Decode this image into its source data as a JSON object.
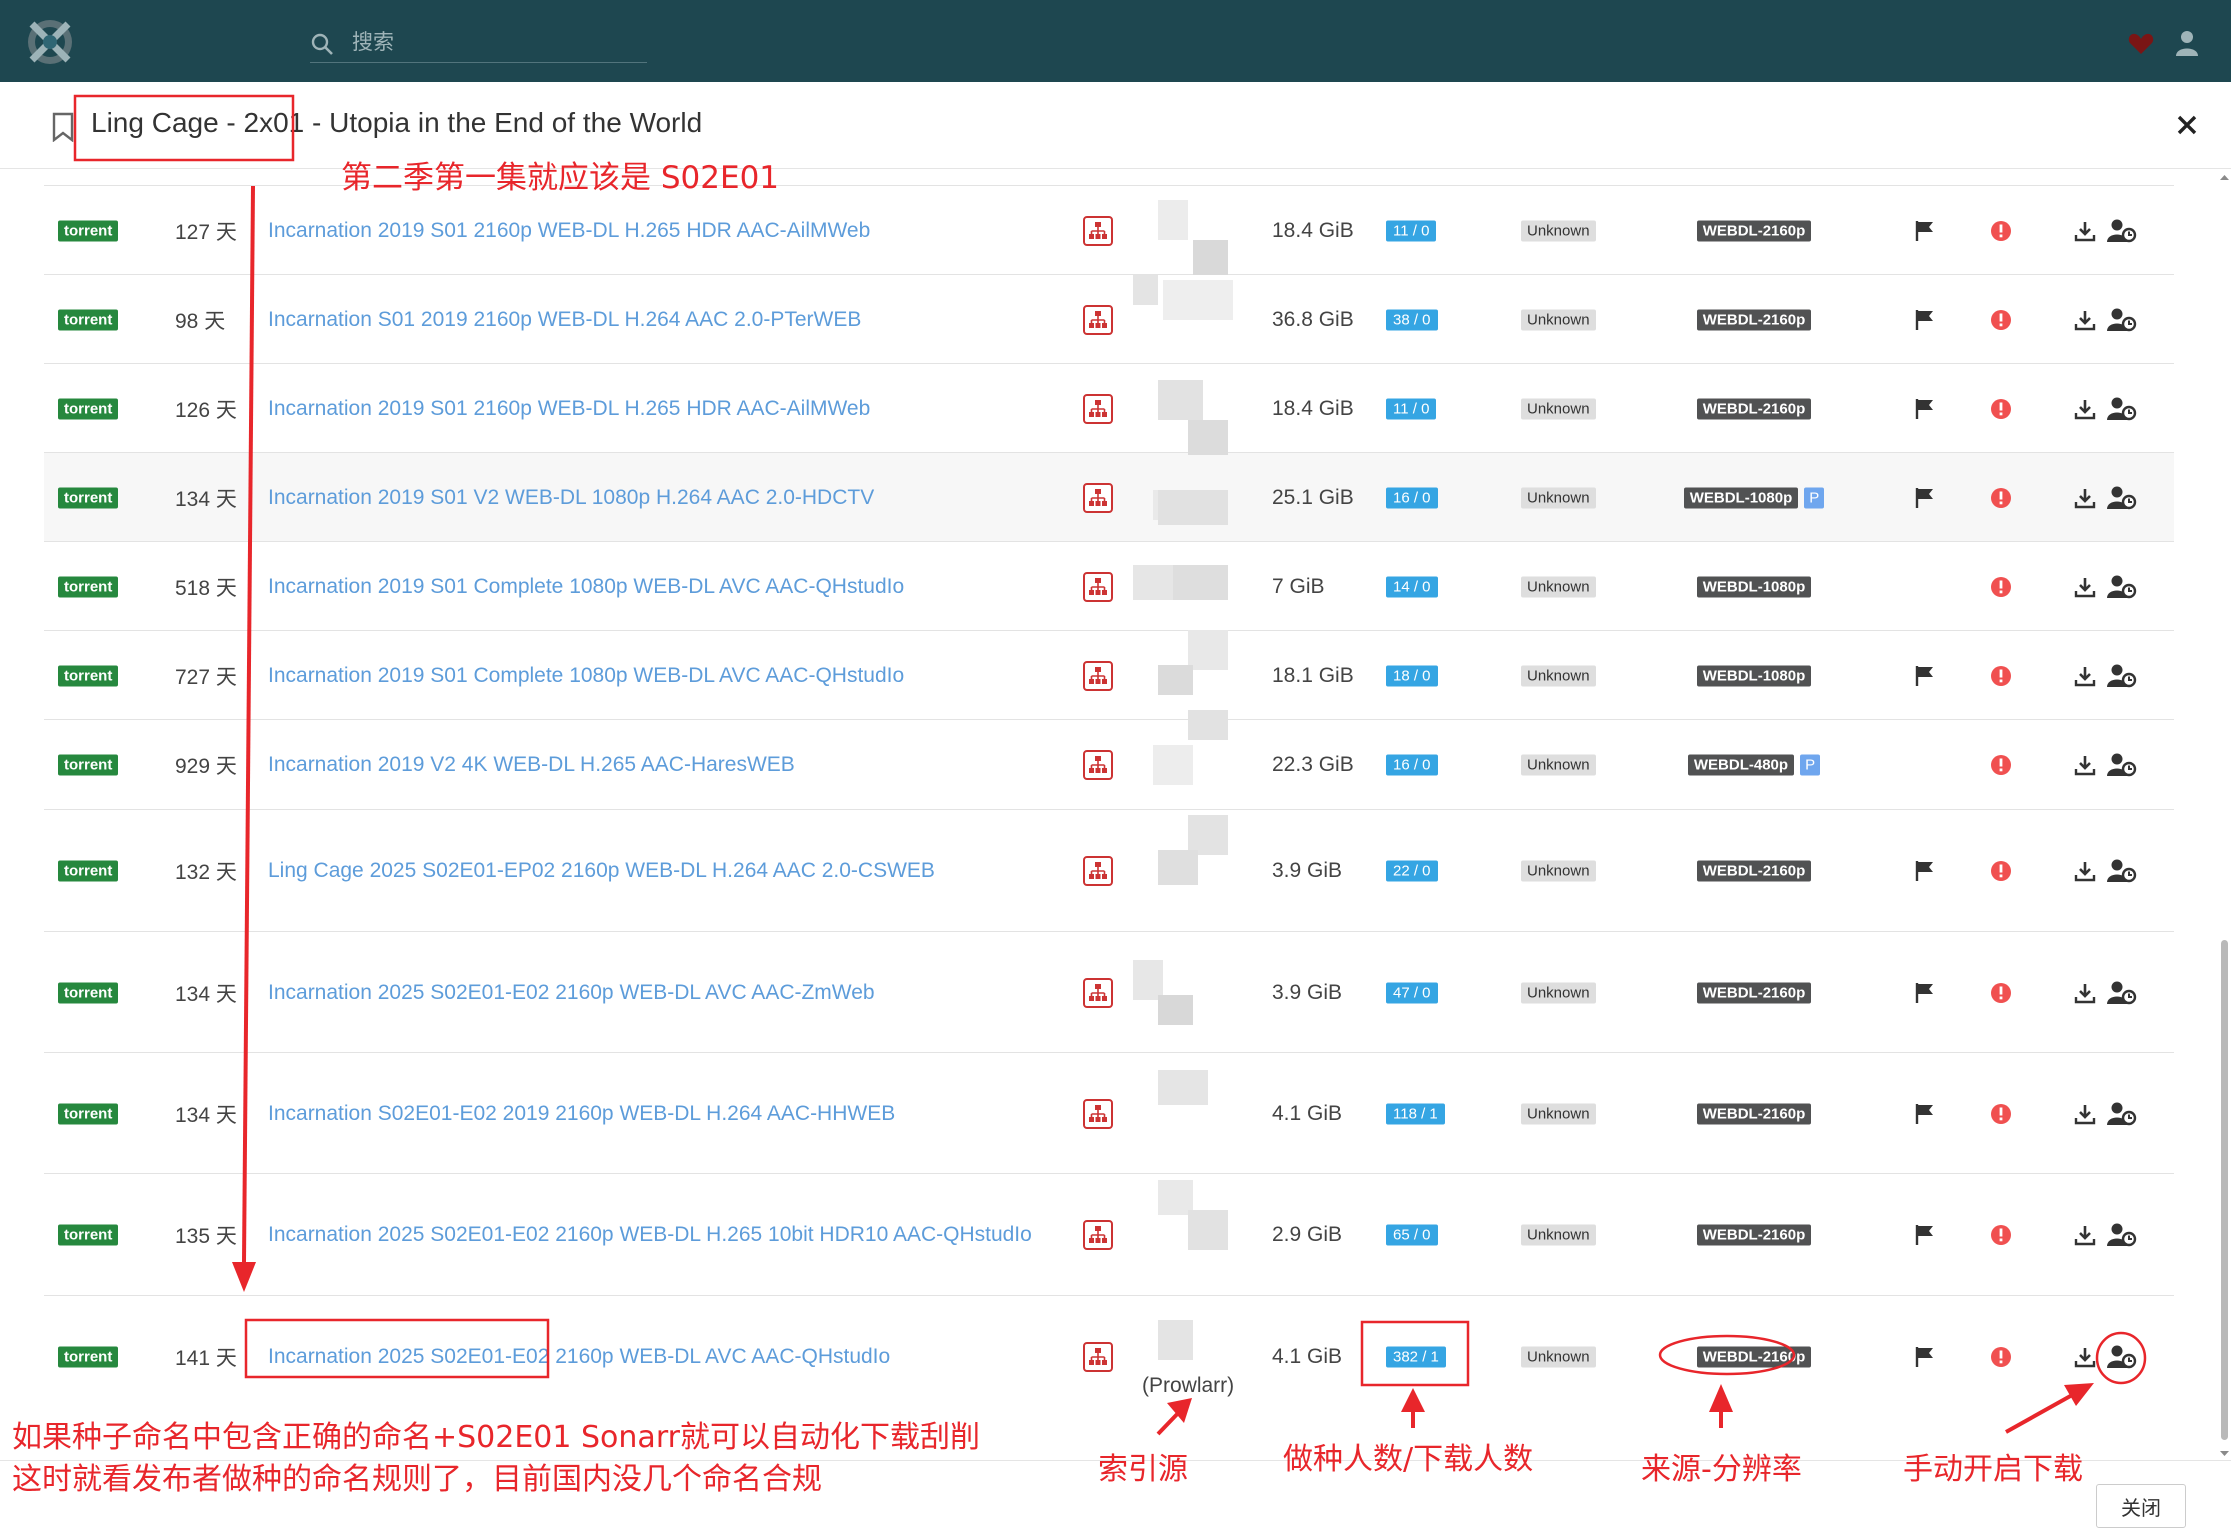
{
  "header": {
    "search_placeholder": "搜索"
  },
  "modal": {
    "title": "Ling Cage - 2x01 - Utopia in the End of the World",
    "close_label": "关闭"
  },
  "releases": [
    {
      "protocol": "torrent",
      "age": "127 天",
      "title": "Incarnation 2019 S01 2160p WEB-DL H.265 HDR AAC-AilMWeb",
      "size": "18.4 GiB",
      "peers": "11 / 0",
      "language": "Unknown",
      "quality": "WEBDL-2160p",
      "proper": "",
      "flag": true
    },
    {
      "protocol": "torrent",
      "age": "98 天",
      "title": "Incarnation S01 2019 2160p WEB-DL H.264 AAC 2.0-PTerWEB",
      "size": "36.8 GiB",
      "peers": "38 / 0",
      "language": "Unknown",
      "quality": "WEBDL-2160p",
      "proper": "",
      "flag": true
    },
    {
      "protocol": "torrent",
      "age": "126 天",
      "title": "Incarnation 2019 S01 2160p WEB-DL H.265 HDR AAC-AilMWeb",
      "size": "18.4 GiB",
      "peers": "11 / 0",
      "language": "Unknown",
      "quality": "WEBDL-2160p",
      "proper": "",
      "flag": true
    },
    {
      "protocol": "torrent",
      "age": "134 天",
      "title": "Incarnation 2019 S01 V2 WEB-DL 1080p H.264 AAC 2.0-HDCTV",
      "size": "25.1 GiB",
      "peers": "16 / 0",
      "language": "Unknown",
      "quality": "WEBDL-1080p",
      "proper": "P",
      "flag": true
    },
    {
      "protocol": "torrent",
      "age": "518 天",
      "title": "Incarnation 2019 S01 Complete 1080p WEB-DL AVC AAC-QHstudIo",
      "size": "7 GiB",
      "peers": "14 / 0",
      "language": "Unknown",
      "quality": "WEBDL-1080p",
      "proper": "",
      "flag": false
    },
    {
      "protocol": "torrent",
      "age": "727 天",
      "title": "Incarnation 2019 S01 Complete 1080p WEB-DL AVC AAC-QHstudIo",
      "size": "18.1 GiB",
      "peers": "18 / 0",
      "language": "Unknown",
      "quality": "WEBDL-1080p",
      "proper": "",
      "flag": true
    },
    {
      "protocol": "torrent",
      "age": "929 天",
      "title": "Incarnation 2019 V2 4K WEB-DL H.265 AAC-HaresWEB",
      "size": "22.3 GiB",
      "peers": "16 / 0",
      "language": "Unknown",
      "quality": "WEBDL-480p",
      "proper": "P",
      "flag": false
    },
    {
      "protocol": "torrent",
      "age": "132 天",
      "title": "Ling Cage 2025 S02E01-EP02 2160p WEB-DL H.264 AAC 2.0-CSWEB",
      "size": "3.9 GiB",
      "peers": "22 / 0",
      "language": "Unknown",
      "quality": "WEBDL-2160p",
      "proper": "",
      "flag": true
    },
    {
      "protocol": "torrent",
      "age": "134 天",
      "title": "Incarnation 2025 S02E01-E02 2160p WEB-DL AVC AAC-ZmWeb",
      "size": "3.9 GiB",
      "peers": "47 / 0",
      "language": "Unknown",
      "quality": "WEBDL-2160p",
      "proper": "",
      "flag": true
    },
    {
      "protocol": "torrent",
      "age": "134 天",
      "title": "Incarnation S02E01-E02 2019 2160p WEB-DL H.264 AAC-HHWEB",
      "size": "4.1 GiB",
      "peers": "118 / 1",
      "language": "Unknown",
      "quality": "WEBDL-2160p",
      "proper": "",
      "flag": true
    },
    {
      "protocol": "torrent",
      "age": "135 天",
      "title": "Incarnation 2025 S02E01-E02 2160p WEB-DL H.265 10bit HDR10 AAC-QHstudIo",
      "size": "2.9 GiB",
      "peers": "65 / 0",
      "language": "Unknown",
      "quality": "WEBDL-2160p",
      "proper": "",
      "flag": true
    },
    {
      "protocol": "torrent",
      "age": "141 天",
      "title": "Incarnation 2025 S02E01-E02 2160p WEB-DL AVC AAC-QHstudIo",
      "size": "4.1 GiB",
      "peers": "382 / 1",
      "language": "Unknown",
      "quality": "WEBDL-2160p",
      "proper": "",
      "flag": true
    }
  ],
  "indexer_note": "(Prowlarr)",
  "annotations": {
    "season_note": "第二季第一集就应该是 S02E01",
    "naming_note_line1": "如果种子命名中包含正确的命名+S02E01 Sonarr就可以自动化下载刮削",
    "naming_note_line2": "这时就看发布者做种的命名规则了，目前国内没几个命名合规",
    "indexer_label": "索引源",
    "peers_label": "做种人数/下载人数",
    "quality_label": "来源-分辨率",
    "manual_label": "手动开启下载"
  },
  "colors": {
    "topbar": "#1e4750",
    "torrent_badge": "#26883e",
    "peers_badge": "#35a5e3",
    "quality_badge": "#515253",
    "proper_badge": "#6fa6ee",
    "link": "#5d9cda",
    "annotation_red": "#e8262b",
    "reject_red": "#f05050"
  },
  "icons": [
    "logo-icon",
    "search-icon",
    "heart-icon",
    "user-icon",
    "bookmark-icon",
    "close-icon",
    "indexer-icon",
    "flag-icon",
    "reject-icon",
    "download-icon",
    "manual-search-icon"
  ]
}
